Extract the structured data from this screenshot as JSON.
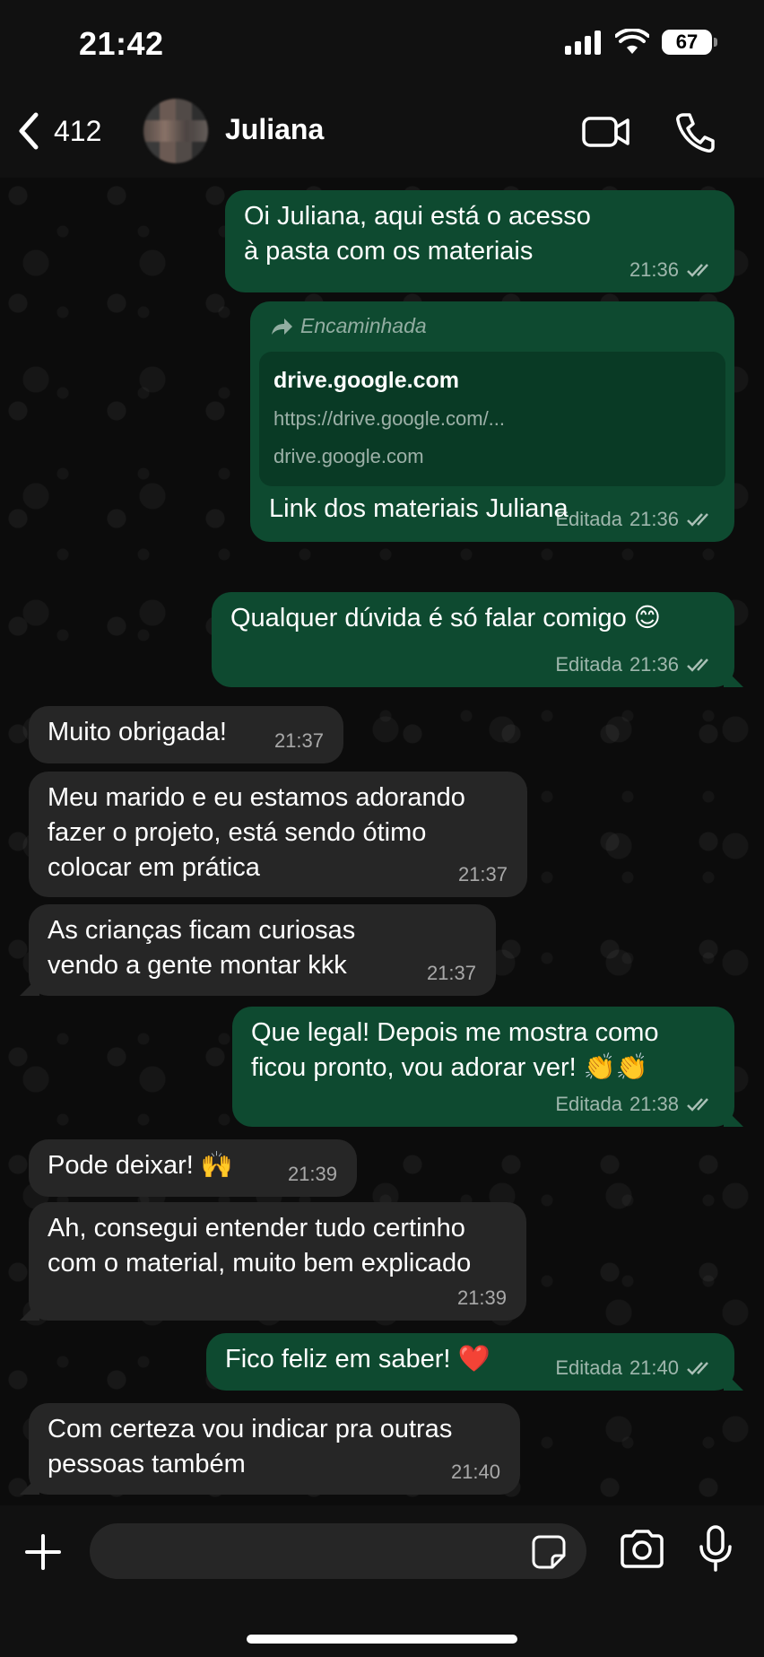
{
  "status_bar": {
    "time": "21:42",
    "battery": "67"
  },
  "header": {
    "back_count": "412",
    "contact_name": "Juliana"
  },
  "messages": [
    {
      "dir": "out",
      "text": "Oi Juliana, aqui está o acesso\nà pasta com os materiais",
      "time": "21:36",
      "edited": "",
      "status": "read"
    },
    {
      "dir": "out",
      "forwarded_label": "Encaminhada",
      "link_preview": {
        "title": "drive.google.com",
        "url": "https://drive.google.com/...",
        "domain": "drive.google.com"
      },
      "text": "Link dos materiais Juliana",
      "time": "21:36",
      "edited": "Editada",
      "status": "read"
    },
    {
      "dir": "out",
      "text": "Qualquer dúvida é só falar comigo 😊",
      "time": "21:36",
      "edited": "Editada",
      "status": "read"
    },
    {
      "dir": "in",
      "text": "Muito obrigada!",
      "time": "21:37"
    },
    {
      "dir": "in",
      "text": "Meu marido e eu estamos adorando\nfazer o projeto, está sendo ótimo\ncolocar em prática",
      "time": "21:37"
    },
    {
      "dir": "in",
      "text": "As crianças ficam curiosas\nvendo a gente montar kkk",
      "time": "21:37"
    },
    {
      "dir": "out",
      "text": "Que legal! Depois me mostra como\nficou pronto, vou adorar ver! 👏👏",
      "time": "21:38",
      "edited": "Editada",
      "status": "read"
    },
    {
      "dir": "in",
      "text": "Pode deixar! 🙌",
      "time": "21:39"
    },
    {
      "dir": "in",
      "text": "Ah, consegui entender tudo certinho\ncom o material, muito bem explicado",
      "time": "21:39"
    },
    {
      "dir": "out",
      "text": "Fico feliz em saber! ❤️",
      "time": "21:40",
      "edited": "Editada",
      "status": "read"
    },
    {
      "dir": "in",
      "text": "Com certeza vou indicar pra outras\npessoas também",
      "time": "21:40"
    }
  ],
  "input": {
    "placeholder": ""
  },
  "icons": {
    "back": "chevron-left-icon",
    "video": "video-camera-icon",
    "call": "phone-icon",
    "attach": "plus-icon",
    "sticker": "sticker-icon",
    "camera": "camera-icon",
    "mic": "microphone-icon",
    "read": "double-check-icon",
    "forward": "forward-arrow-icon"
  },
  "colors": {
    "outgoing_bubble": "#0e4a30",
    "incoming_bubble": "#262626",
    "background": "#0b0b0b"
  }
}
